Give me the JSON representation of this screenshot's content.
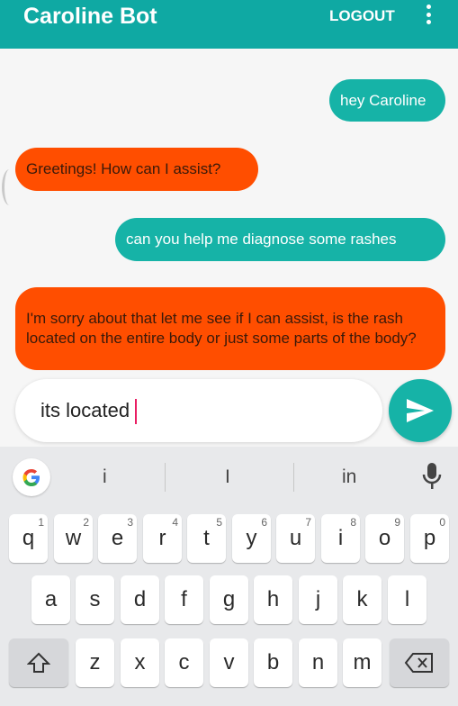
{
  "appbar": {
    "title": "Caroline Bot",
    "logout_label": "LOGOUT"
  },
  "messages": [
    {
      "sender": "user",
      "text": "hey Caroline"
    },
    {
      "sender": "bot",
      "text": "Greetings! How can I assist?"
    },
    {
      "sender": "user",
      "text": "can you help me diagnose some rashes"
    },
    {
      "sender": "bot",
      "text": "I'm sorry about that let me see if I can assist, is the rash located on the entire body or just some parts of the body?"
    }
  ],
  "composer": {
    "value": "its located"
  },
  "keyboard": {
    "suggestions": [
      "i",
      "I",
      "in"
    ],
    "row1": [
      {
        "k": "q",
        "n": "1"
      },
      {
        "k": "w",
        "n": "2"
      },
      {
        "k": "e",
        "n": "3"
      },
      {
        "k": "r",
        "n": "4"
      },
      {
        "k": "t",
        "n": "5"
      },
      {
        "k": "y",
        "n": "6"
      },
      {
        "k": "u",
        "n": "7"
      },
      {
        "k": "i",
        "n": "8"
      },
      {
        "k": "o",
        "n": "9"
      },
      {
        "k": "p",
        "n": "0"
      }
    ],
    "row2": [
      "a",
      "s",
      "d",
      "f",
      "g",
      "h",
      "j",
      "k",
      "l"
    ],
    "row3": [
      "z",
      "x",
      "c",
      "v",
      "b",
      "n",
      "m"
    ]
  },
  "colors": {
    "appbar": "#0fa9a3",
    "user_bubble": "#16b3a7",
    "bot_bubble": "#ff4e00"
  },
  "icons": {
    "menu": "more-vert-icon",
    "send": "send-icon",
    "google": "google-icon",
    "mic": "mic-icon",
    "shift": "shift-icon",
    "backspace": "backspace-icon"
  }
}
